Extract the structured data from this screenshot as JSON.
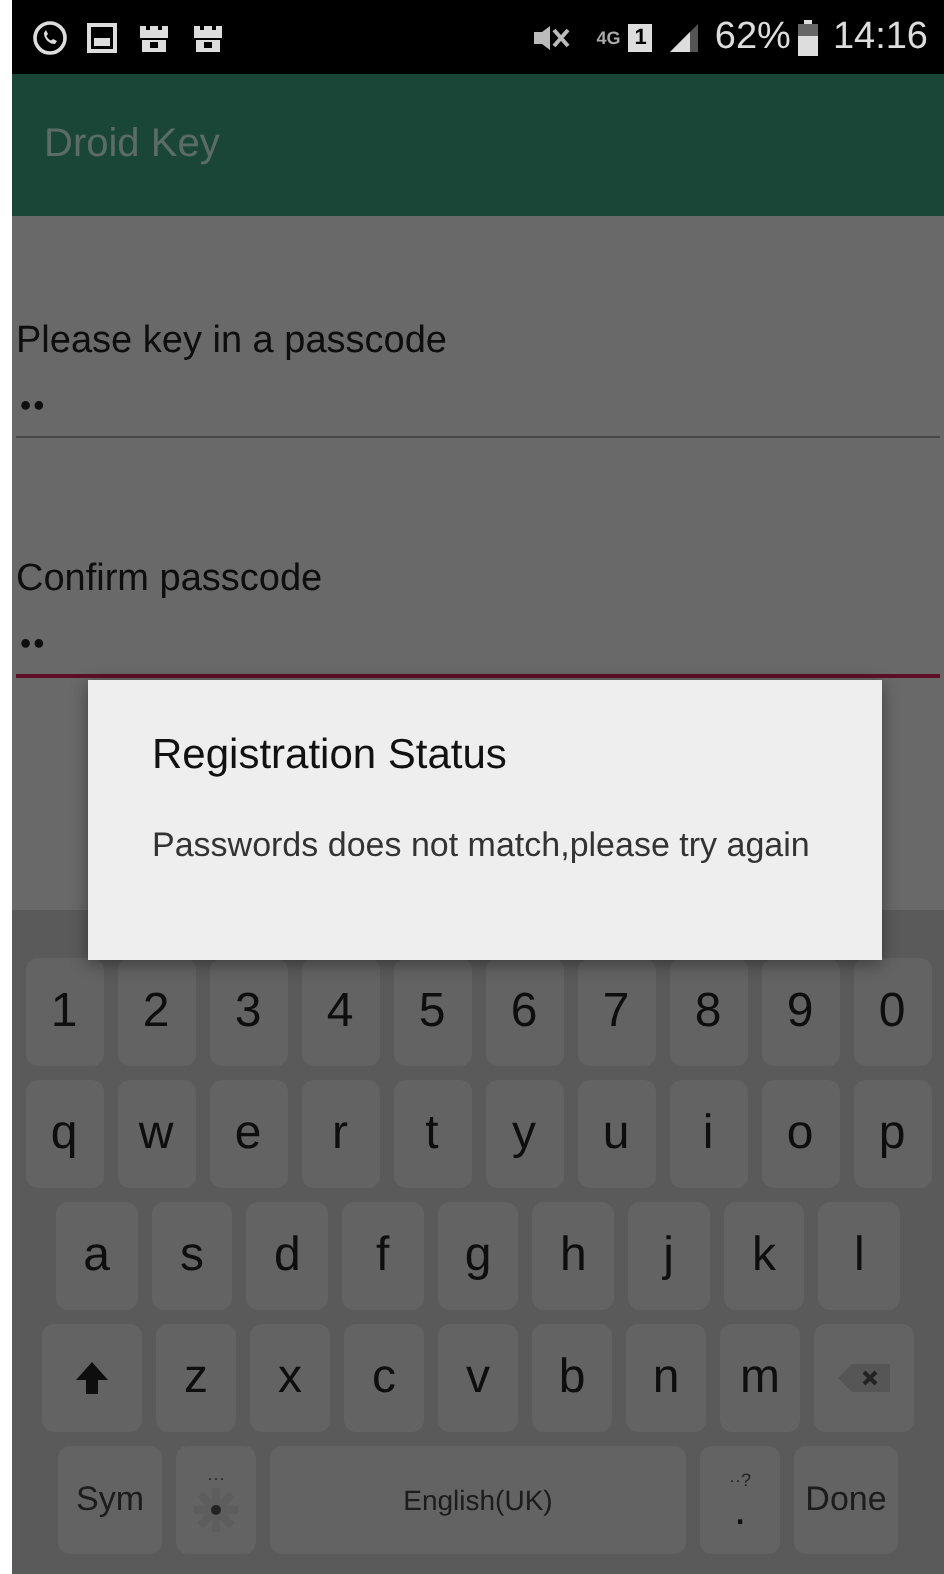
{
  "status_bar": {
    "network": "4G",
    "sim": "1",
    "battery": "62%",
    "time": "14:16"
  },
  "app_bar": {
    "title": "Droid Key"
  },
  "fields": [
    {
      "label": "Please key in a passcode",
      "value": "••",
      "error": false
    },
    {
      "label": "Confirm passcode",
      "value": "••",
      "error": true
    }
  ],
  "dialog": {
    "title": "Registration Status",
    "message": "Passwords does not match,please try again"
  },
  "keyboard": {
    "rows": [
      {
        "keys": [
          {
            "kind": "char",
            "label": "1"
          },
          {
            "kind": "char",
            "label": "2"
          },
          {
            "kind": "char",
            "label": "3"
          },
          {
            "kind": "char",
            "label": "4"
          },
          {
            "kind": "char",
            "label": "5"
          },
          {
            "kind": "char",
            "label": "6"
          },
          {
            "kind": "char",
            "label": "7"
          },
          {
            "kind": "char",
            "label": "8"
          },
          {
            "kind": "char",
            "label": "9"
          },
          {
            "kind": "char",
            "label": "0"
          }
        ]
      },
      {
        "keys": [
          {
            "kind": "char",
            "label": "q"
          },
          {
            "kind": "char",
            "label": "w"
          },
          {
            "kind": "char",
            "label": "e"
          },
          {
            "kind": "char",
            "label": "r"
          },
          {
            "kind": "char",
            "label": "t"
          },
          {
            "kind": "char",
            "label": "y"
          },
          {
            "kind": "char",
            "label": "u"
          },
          {
            "kind": "char",
            "label": "i"
          },
          {
            "kind": "char",
            "label": "o"
          },
          {
            "kind": "char",
            "label": "p"
          }
        ]
      },
      {
        "keys": [
          {
            "kind": "char",
            "label": "a"
          },
          {
            "kind": "char",
            "label": "s"
          },
          {
            "kind": "char",
            "label": "d"
          },
          {
            "kind": "char",
            "label": "f"
          },
          {
            "kind": "char",
            "label": "g"
          },
          {
            "kind": "char",
            "label": "h"
          },
          {
            "kind": "char",
            "label": "j"
          },
          {
            "kind": "char",
            "label": "k"
          },
          {
            "kind": "char",
            "label": "l"
          }
        ]
      },
      {
        "keys": [
          {
            "kind": "shift"
          },
          {
            "kind": "char",
            "label": "z"
          },
          {
            "kind": "char",
            "label": "x"
          },
          {
            "kind": "char",
            "label": "c"
          },
          {
            "kind": "char",
            "label": "v"
          },
          {
            "kind": "char",
            "label": "b"
          },
          {
            "kind": "char",
            "label": "n"
          },
          {
            "kind": "char",
            "label": "m"
          },
          {
            "kind": "backspace"
          }
        ]
      },
      {
        "keys": [
          {
            "kind": "wide",
            "label": "Sym"
          },
          {
            "kind": "settings",
            "hint": "···"
          },
          {
            "kind": "space",
            "label": "English(UK)"
          },
          {
            "kind": "period",
            "label": ".",
            "hint": "··?"
          },
          {
            "kind": "wide",
            "label": "Done"
          }
        ]
      }
    ]
  }
}
